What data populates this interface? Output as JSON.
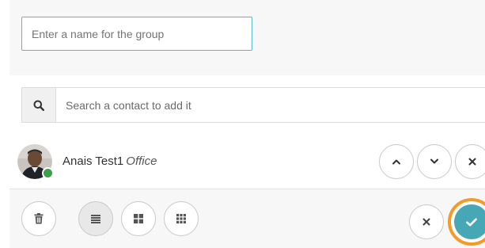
{
  "group_form": {
    "name_placeholder": "Enter a name for the group",
    "name_value": ""
  },
  "search": {
    "placeholder": "Search a contact to add it",
    "value": ""
  },
  "contacts": [
    {
      "name": "Anais Test1",
      "label": "Office",
      "presence": "online"
    }
  ],
  "colors": {
    "accent": "#46a7b5",
    "input_border": "#5bb8c8",
    "presence_online": "#3aa04a",
    "highlight_ring": "#f39a27"
  },
  "icons": {
    "search": "search-icon",
    "move_up": "chevron-up-icon",
    "move_down": "chevron-down-icon",
    "remove": "close-icon",
    "delete": "trash-icon",
    "list_view": "list-view-icon",
    "grid_view": "grid-view-icon",
    "small_grid_view": "small-grid-view-icon",
    "cancel": "close-icon",
    "confirm": "check-icon"
  },
  "view_mode": "list"
}
